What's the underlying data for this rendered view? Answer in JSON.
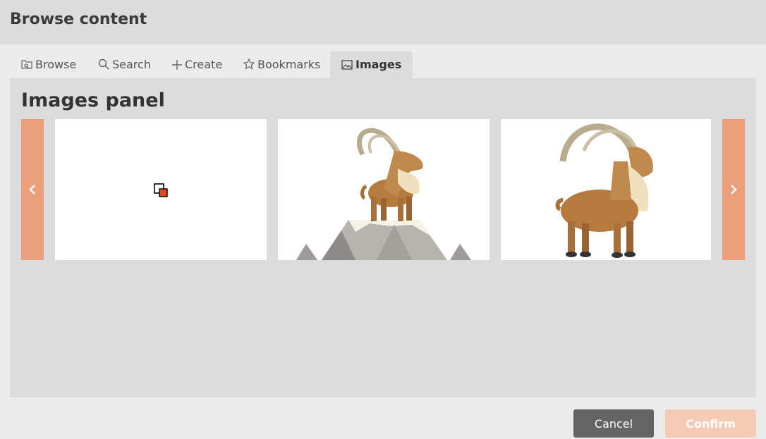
{
  "header": {
    "title": "Browse content"
  },
  "tabs": [
    {
      "label": "Browse",
      "icon": "browse-icon"
    },
    {
      "label": "Search",
      "icon": "search-icon"
    },
    {
      "label": "Create",
      "icon": "plus-icon"
    },
    {
      "label": "Bookmarks",
      "icon": "star-icon"
    },
    {
      "label": "Images",
      "icon": "image-icon",
      "active": true
    }
  ],
  "panel": {
    "title": "Images panel",
    "prev_icon": "chevron-left-icon",
    "next_icon": "chevron-right-icon",
    "images": [
      {
        "content": "broken-image-icon"
      },
      {
        "content": "ibex-on-mountain"
      },
      {
        "content": "ibex-standing"
      }
    ]
  },
  "footer": {
    "cancel_label": "Cancel",
    "confirm_label": "Confirm"
  },
  "colors": {
    "accent": "#eba07b",
    "confirm_disabled": "#f5cbb6",
    "cancel": "#646464"
  }
}
